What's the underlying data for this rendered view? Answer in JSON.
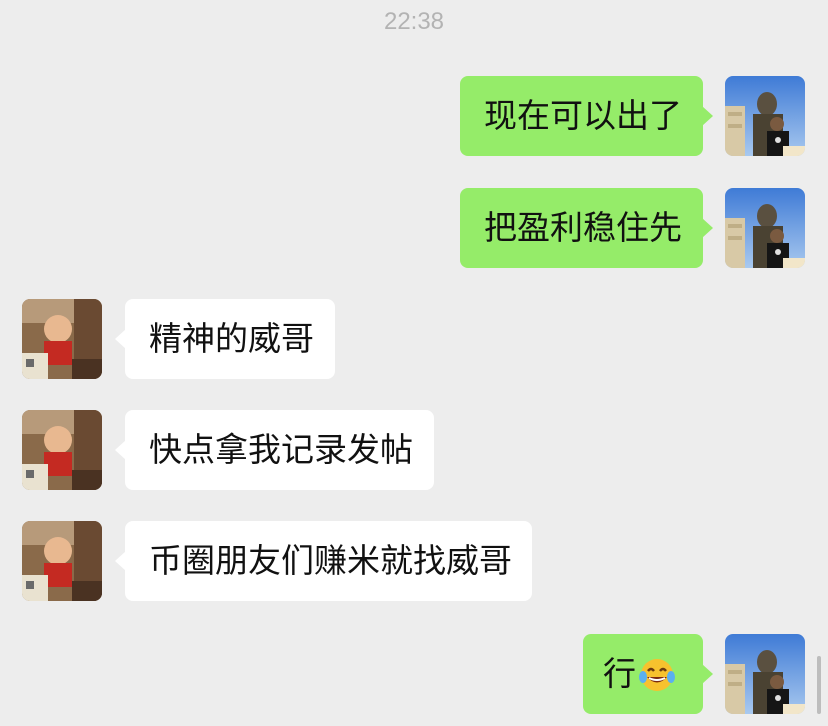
{
  "chat": {
    "timestamp": "22:38",
    "messages": [
      {
        "sender": "me",
        "text": "现在可以出了"
      },
      {
        "sender": "me",
        "text": "把盈利稳住先"
      },
      {
        "sender": "other",
        "text": "精神的威哥"
      },
      {
        "sender": "other",
        "text": "快点拿我记录发帖"
      },
      {
        "sender": "other",
        "text": "币圈朋友们赚米就找威哥"
      },
      {
        "sender": "me",
        "text": "行",
        "emoji": "face-with-tears-of-joy"
      }
    ]
  },
  "colors": {
    "background": "#ededed",
    "my_bubble": "#95ec69",
    "their_bubble": "#ffffff",
    "timestamp_text": "#b3b3b3"
  },
  "icons": {
    "my_avatar": "avatar-photo-man-statue",
    "their_avatar": "avatar-photo-baby",
    "emoji": "face-with-tears-of-joy-icon"
  }
}
